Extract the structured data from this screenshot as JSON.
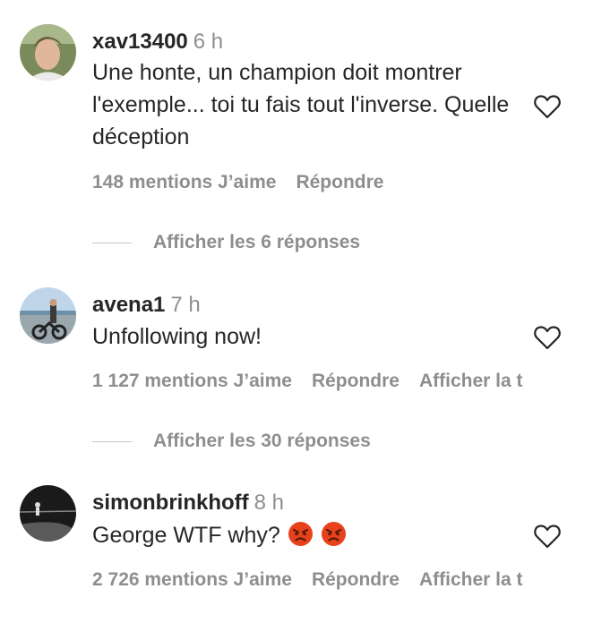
{
  "comments": [
    {
      "username": "xav13400",
      "time": "6 h",
      "text": "Une honte, un champion doit montrer l'exemple... toi tu fais tout l'inverse. Quelle déception",
      "likes": "148 mentions J’aime",
      "reply": "Répondre",
      "translate": "",
      "replies": "Afficher les 6 réponses"
    },
    {
      "username": "avena1",
      "time": "7 h",
      "text": "Unfollowing now!",
      "likes": "1 127 mentions J’aime",
      "reply": "Répondre",
      "translate": "Afficher la t",
      "replies": "Afficher les 30 réponses"
    },
    {
      "username": "simonbrinkhoff",
      "time": "8 h",
      "text": "George WTF why?",
      "emojis": [
        "angry-face",
        "angry-face"
      ],
      "likes": "2 726 mentions J’aime",
      "reply": "Répondre",
      "translate": "Afficher la t"
    }
  ],
  "colors": {
    "text": "#262626",
    "secondary": "#8e8e8e",
    "divider": "#c7c7c7",
    "angry_emoji": "#e8421c"
  },
  "icons": {
    "like": "heart-outline-icon"
  }
}
